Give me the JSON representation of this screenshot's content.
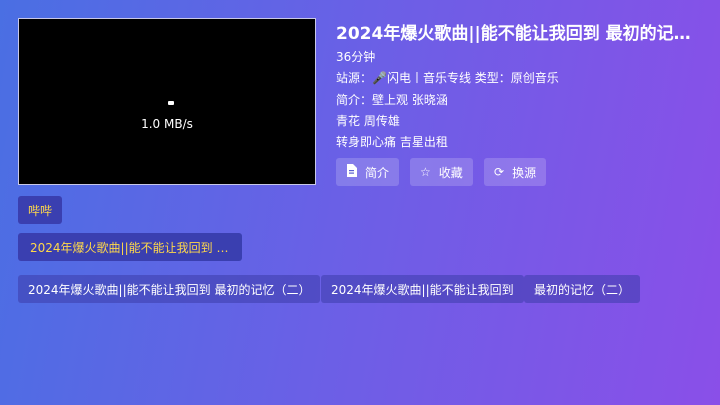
{
  "player": {
    "speed": "1.0 MB/s"
  },
  "detail": {
    "title": "2024年爆火歌曲||能不能让我回到 最初的记忆（二）",
    "duration": "36分钟",
    "site_type": "站源：🎤闪电丨音乐专线  类型：原创音乐",
    "intro_line1": "简介：壁上观 张晓涵",
    "intro_line2": "青花 周传雄",
    "intro_line3": "转身即心痛 吉星出租"
  },
  "actions": {
    "intro_label": "简介",
    "fav_label": "收藏",
    "switch_label": "换源"
  },
  "source": {
    "label": "哔哔"
  },
  "episodes": {
    "current": "2024年爆火歌曲||能不能让我回到 最...",
    "items": [
      "2024年爆火歌曲||能不能让我回到 最初的记忆（二）",
      "2024年爆火歌曲||能不能让我回到",
      "最初的记忆（二）"
    ]
  }
}
